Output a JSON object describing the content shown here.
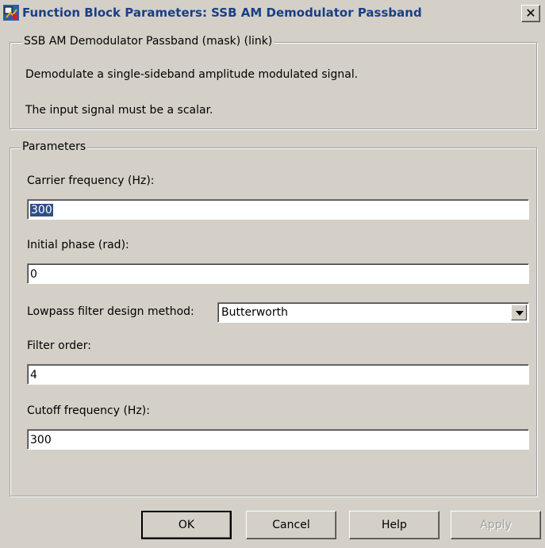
{
  "window": {
    "title": "Function Block Parameters: SSB AM Demodulator Passband",
    "close_glyph": "✕"
  },
  "mask": {
    "legend": "SSB AM Demodulator Passband (mask) (link)",
    "description": "Demodulate a single-sideband amplitude modulated signal.",
    "note": "The input signal must be a scalar."
  },
  "params": {
    "legend": "Parameters",
    "carrier_label": "Carrier frequency (Hz):",
    "carrier_value": "300",
    "phase_label": "Initial phase (rad):",
    "phase_value": "0",
    "filter_method_label": "Lowpass filter design method:",
    "filter_method_value": "Butterworth",
    "order_label": "Filter order:",
    "order_value": "4",
    "cutoff_label": "Cutoff frequency (Hz):",
    "cutoff_value": "300"
  },
  "buttons": {
    "ok": "OK",
    "cancel": "Cancel",
    "help": "Help",
    "apply": "Apply"
  },
  "icons": {
    "app": "simulink-block-icon",
    "close": "close-icon",
    "dropdown": "chevron-down-icon"
  }
}
